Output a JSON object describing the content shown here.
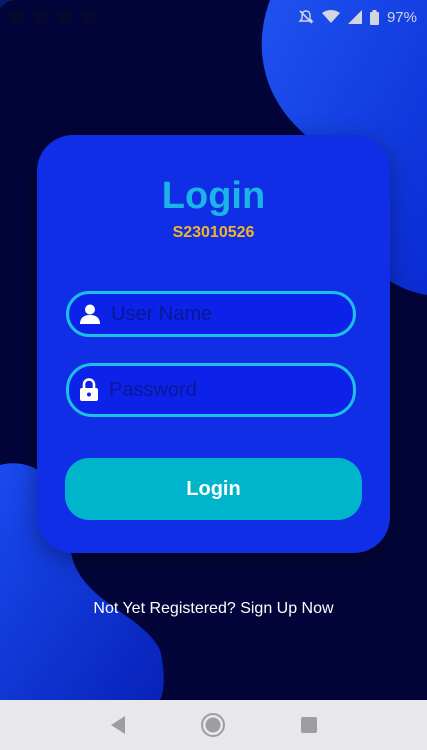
{
  "status_bar": {
    "battery_percent": "97%",
    "icons": [
      "mute-icon",
      "wifi-icon",
      "signal-icon",
      "battery-icon"
    ]
  },
  "login_card": {
    "title": "Login",
    "subtitle": "S23010526",
    "username_placeholder": "User Name",
    "password_placeholder": "Password",
    "login_button_label": "Login"
  },
  "signup_link": "Not Yet Registered? Sign Up Now",
  "nav_bar": {
    "buttons": [
      "back-icon",
      "home-icon",
      "recents-icon"
    ]
  },
  "colors": {
    "background": "#03053a",
    "card": "#0f2ee6",
    "title": "#1ab4e6",
    "subtitle": "#f1b52b",
    "field_border": "#1cc0e6",
    "button": "#00b4cc"
  }
}
